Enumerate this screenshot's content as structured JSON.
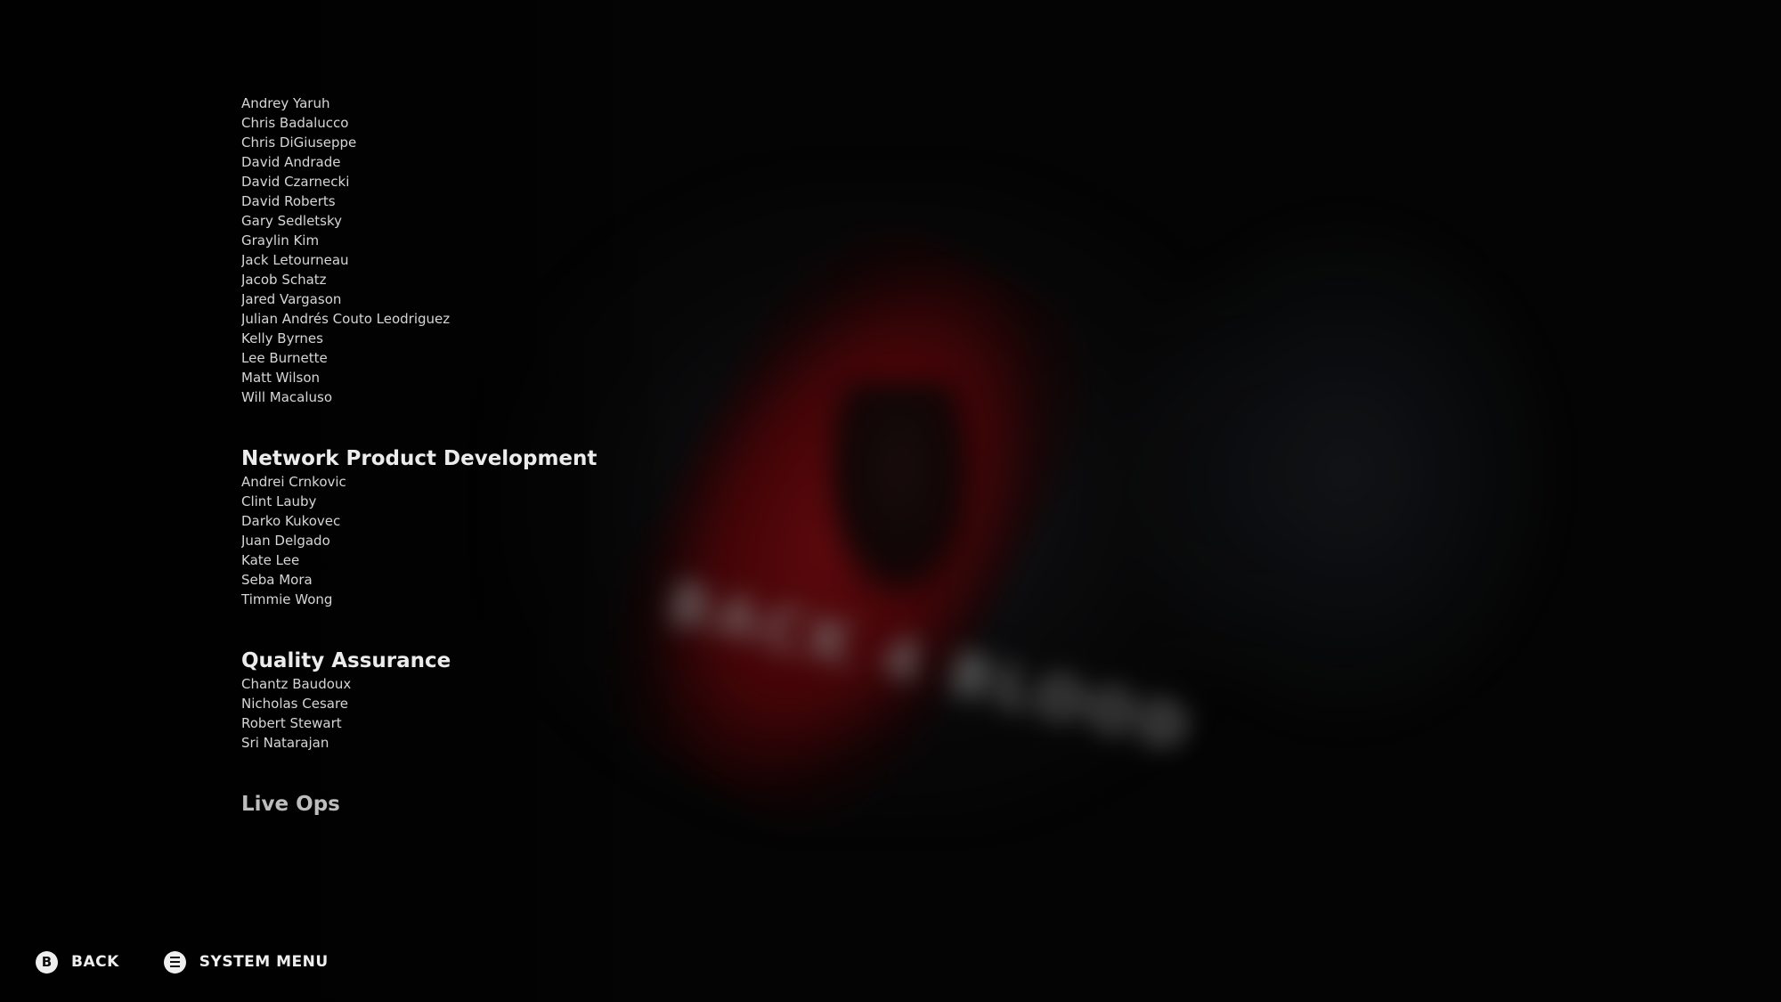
{
  "background": {
    "logo_text": "BACK 4 BLOOD",
    "accent_color": "#6a0a0e"
  },
  "credits": {
    "partial_name": "Andrey Yaruh",
    "names_top": [
      "Chris Badalucco",
      "Chris DiGiuseppe",
      "David Andrade",
      "David Czarnecki",
      "David Roberts",
      "Gary Sedletsky",
      "Graylin Kim",
      "Jack Letourneau",
      "Jacob Schatz",
      "Jared Vargason",
      "Julian Andrés Couto Leodriguez",
      "Kelly Byrnes",
      "Lee Burnette",
      "Matt Wilson",
      "Will Macaluso"
    ],
    "sections": [
      {
        "title": "Network Product Development",
        "names": [
          "Andrei Crnkovic",
          "Clint Lauby",
          "Darko Kukovec",
          "Juan Delgado",
          "Kate Lee",
          "Seba Mora",
          "Timmie Wong"
        ]
      },
      {
        "title": "Quality Assurance",
        "names": [
          "Chantz Baudoux",
          "Nicholas Cesare",
          "Robert Stewart",
          "Sri Natarajan"
        ]
      },
      {
        "title": "Live Ops",
        "names": []
      }
    ]
  },
  "footer": {
    "back": {
      "glyph": "B",
      "label": "BACK"
    },
    "system_menu": {
      "label": "SYSTEM MENU"
    }
  }
}
